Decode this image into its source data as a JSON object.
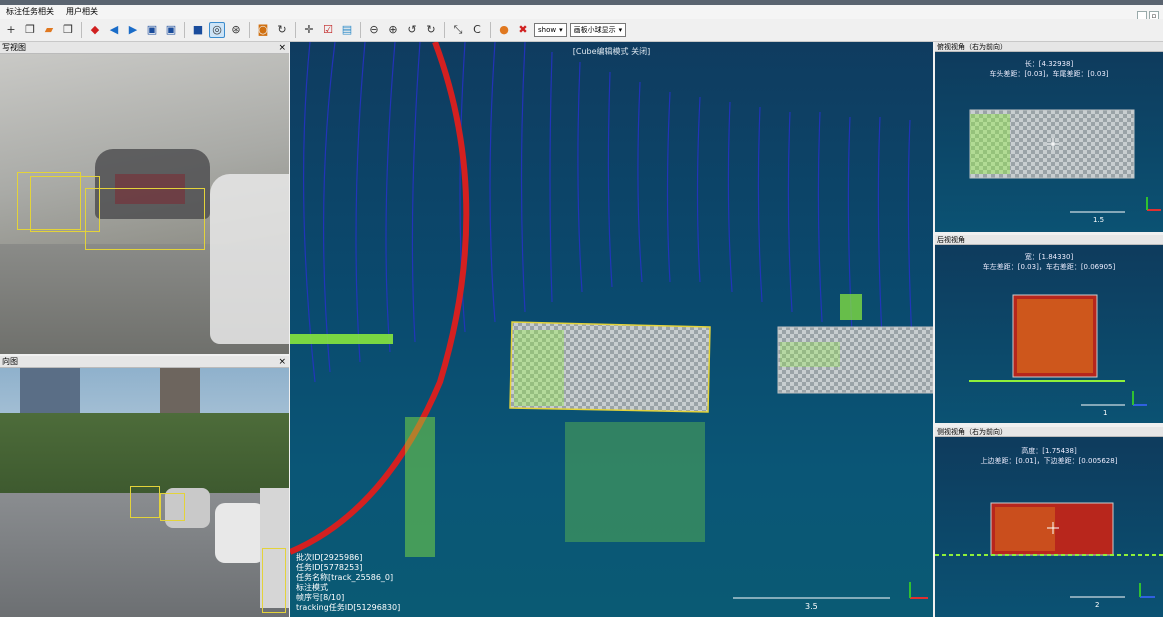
{
  "menubar": {
    "items": [
      "标注任务相关",
      "用户相关"
    ]
  },
  "toolbar": {
    "show_select": "show",
    "ball_select": "画板小球显示"
  },
  "panels": {
    "camera_top": {
      "title": "写视图",
      "close": "×"
    },
    "camera_front": {
      "title": "向图",
      "close": "×"
    }
  },
  "main_view": {
    "mode_label": "[Cube编辑模式 关闭]",
    "info_lines": [
      "批次ID[2925986]",
      "任务ID[5778253]",
      "任务名称[track_25586_0]",
      "标注模式",
      "帧序号[8/10]",
      "tracking任务ID[51296830]"
    ],
    "scale_label": "3.5"
  },
  "right_views": {
    "top": {
      "title": "俯视视角（右为前向）",
      "line1": "长：[4.32938]",
      "line2": "车头差距：[0.03]，车尾差距：[0.03]",
      "scale": "1.5"
    },
    "back": {
      "title": "后视视角",
      "line1": "宽：[1.84330]",
      "line2": "车左差距：[0.03]，车右差距：[0.06905]",
      "scale": "1"
    },
    "side": {
      "title": "侧视视角（右为前向）",
      "line1": "高度：[1.75438]",
      "line2": "上边差距：[0.01]，下边差距：[0.005628]",
      "scale": "2"
    }
  },
  "colors": {
    "point_blue": "#2632c8",
    "point_green": "#8ef03a",
    "box_outline": "#e3d33a",
    "ring_red": "#d42020",
    "box_red": "#b8261c"
  }
}
